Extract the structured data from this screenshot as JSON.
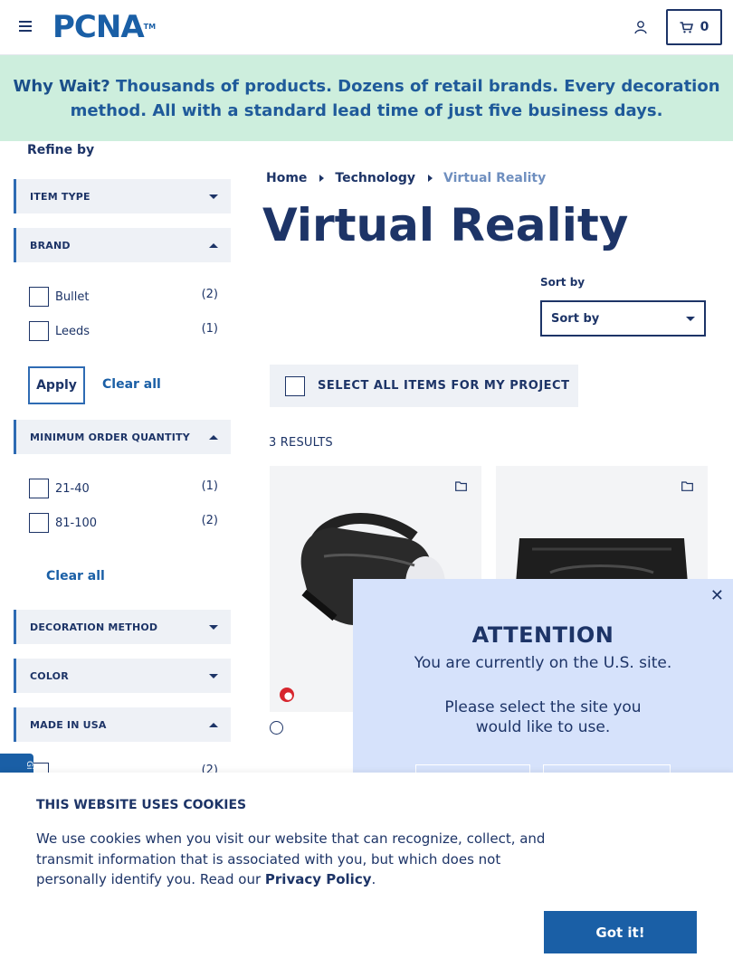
{
  "header": {
    "logo_text": "PCNA",
    "logo_tm": "TM",
    "cart_count": "0"
  },
  "banner": {
    "lead": "Why Wait?",
    "text": " Thousands of products. Dozens of retail brands. Every decoration method. All with a standard lead time of just five business days."
  },
  "sidebar": {
    "refine_label": "Refine by",
    "facets": {
      "item_type": "ITEM TYPE",
      "brand": "BRAND",
      "moq": "MINIMUM ORDER QUANTITY",
      "decoration": "DECORATION METHOD",
      "color": "COLOR",
      "made_in_usa": "MADE IN USA"
    },
    "brand_options": [
      {
        "label": "Bullet",
        "count": "(2)"
      },
      {
        "label": "Leeds",
        "count": "(1)"
      }
    ],
    "moq_options": [
      {
        "label": "21-40",
        "count": "(1)"
      },
      {
        "label": "81-100",
        "count": "(2)"
      }
    ],
    "made_in_usa_count": "(2)",
    "apply_label": "Apply",
    "clear_all_label": "Clear all",
    "feedback_label": "Gi"
  },
  "main": {
    "breadcrumb": [
      "Home",
      "Technology",
      "Virtual Reality"
    ],
    "title": "Virtual Reality",
    "sort_label": "Sort by",
    "sort_value": "Sort by",
    "select_all_label": "SELECT ALL ITEMS FOR MY PROJECT",
    "results": "3 RESULTS"
  },
  "modal": {
    "title": "ATTENTION",
    "line1": "You are currently on the U.S. site.",
    "line2": "Please select the site you",
    "line3": "would like to use.",
    "close": "✕"
  },
  "cookie": {
    "title": "THIS WEBSITE USES COOKIES",
    "text": "We use cookies when you visit our website that can recognize, collect, and transmit information that is associated with you, but which does not personally identify you. Read our ",
    "link": "Privacy Policy",
    "end": ".",
    "button": "Got it!"
  },
  "colors": {
    "navy": "#1d3467",
    "blue": "#1a5fa6",
    "banner_bg": "#cdeedd",
    "modal_bg": "#d6e2fb",
    "facet_bg": "#eef1f6"
  }
}
